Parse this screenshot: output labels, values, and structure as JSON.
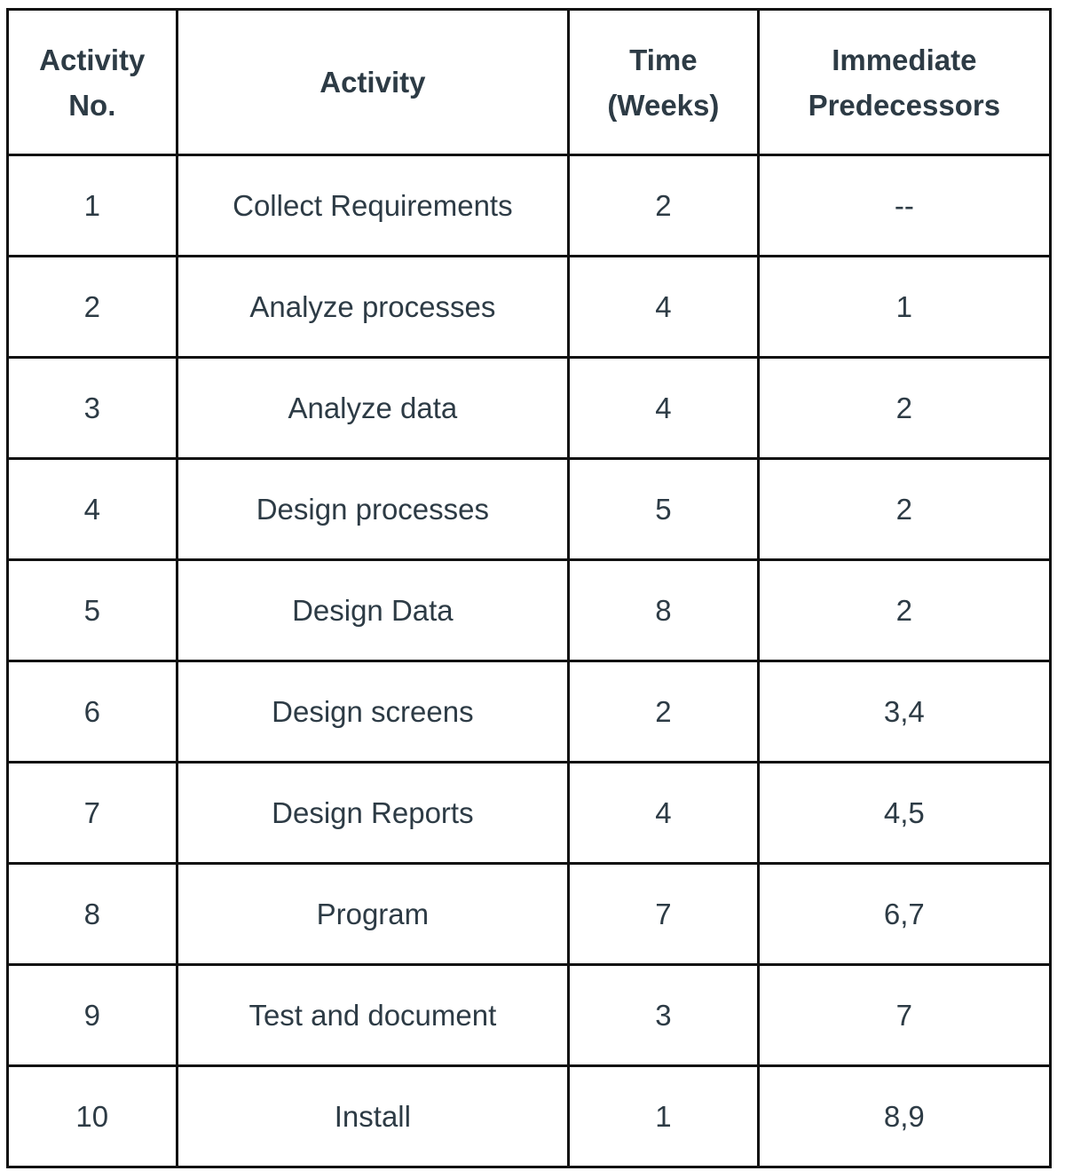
{
  "table": {
    "headers": [
      {
        "line1": "Activity",
        "line2": "No."
      },
      {
        "line1": "Activity",
        "line2": ""
      },
      {
        "line1": "Time",
        "line2": "(Weeks)"
      },
      {
        "line1": "Immediate",
        "line2": "Predecessors"
      }
    ],
    "rows": [
      {
        "no": "1",
        "activity": "Collect Requirements",
        "time": "2",
        "predecessors": "--"
      },
      {
        "no": "2",
        "activity": "Analyze processes",
        "time": "4",
        "predecessors": "1"
      },
      {
        "no": "3",
        "activity": "Analyze data",
        "time": "4",
        "predecessors": "2"
      },
      {
        "no": "4",
        "activity": "Design processes",
        "time": "5",
        "predecessors": "2"
      },
      {
        "no": "5",
        "activity": "Design Data",
        "time": "8",
        "predecessors": "2"
      },
      {
        "no": "6",
        "activity": "Design screens",
        "time": "2",
        "predecessors": "3,4"
      },
      {
        "no": "7",
        "activity": "Design Reports",
        "time": "4",
        "predecessors": "4,5"
      },
      {
        "no": "8",
        "activity": "Program",
        "time": "7",
        "predecessors": "6,7"
      },
      {
        "no": "9",
        "activity": "Test and document",
        "time": "3",
        "predecessors": "7"
      },
      {
        "no": "10",
        "activity": "Install",
        "time": "1",
        "predecessors": "8,9"
      }
    ]
  }
}
